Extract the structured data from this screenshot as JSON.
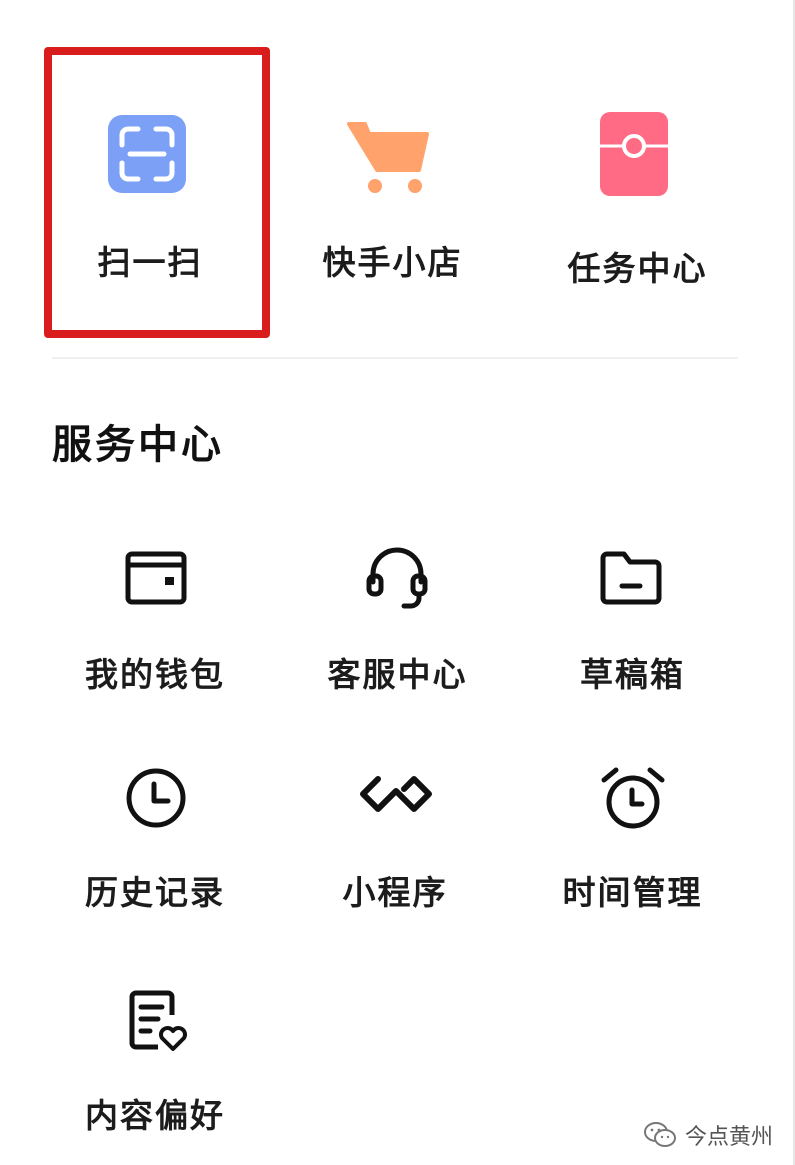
{
  "top_shortcuts": [
    {
      "label": "扫一扫",
      "icon": "scan-icon",
      "color": "#7ba0f5"
    },
    {
      "label": "快手小店",
      "icon": "shopping-cart-icon",
      "color": "#ffa26b"
    },
    {
      "label": "任务中心",
      "icon": "red-envelope-icon",
      "color": "#ff6b85"
    }
  ],
  "service_center": {
    "title": "服务中心",
    "items": [
      {
        "label": "我的钱包",
        "icon": "wallet-icon"
      },
      {
        "label": "客服中心",
        "icon": "headset-icon"
      },
      {
        "label": "草稿箱",
        "icon": "folder-icon"
      },
      {
        "label": "历史记录",
        "icon": "clock-icon"
      },
      {
        "label": "小程序",
        "icon": "mini-program-icon"
      },
      {
        "label": "时间管理",
        "icon": "alarm-clock-icon"
      },
      {
        "label": "内容偏好",
        "icon": "document-heart-icon"
      }
    ]
  },
  "highlight_color": "#d91c1c",
  "watermark": {
    "text": "今点黄州",
    "icon": "wechat-icon"
  }
}
